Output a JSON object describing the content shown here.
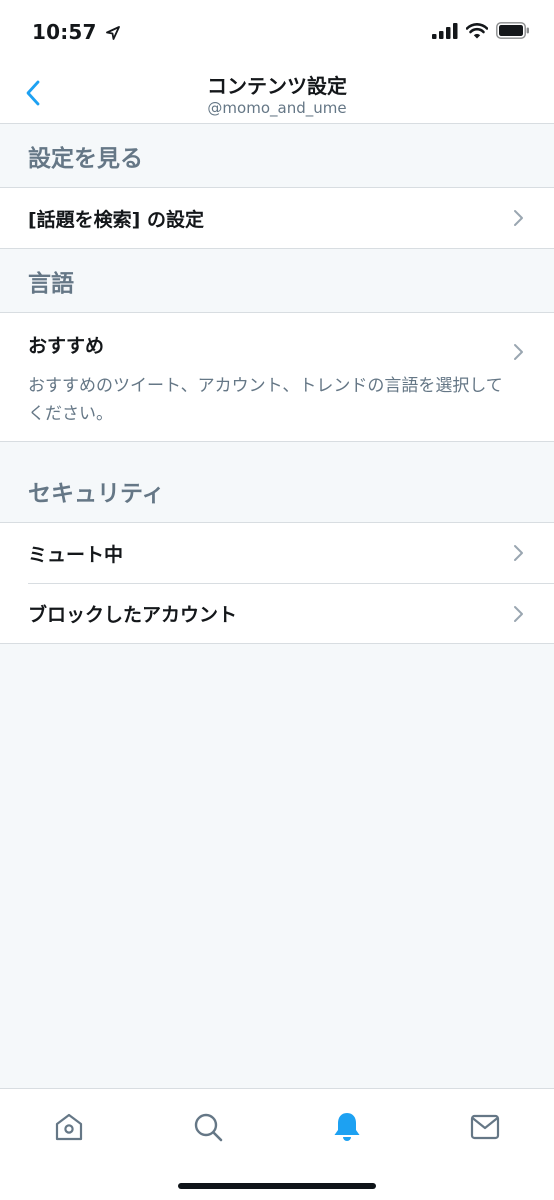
{
  "status_bar": {
    "time": "10:57"
  },
  "nav": {
    "title": "コンテンツ設定",
    "subtitle": "@momo_and_ume"
  },
  "sections": [
    {
      "header": "設定を見る",
      "rows": [
        {
          "label": "[話題を検索] の設定"
        }
      ]
    },
    {
      "header": "言語",
      "rows": [
        {
          "label": "おすすめ",
          "description": "おすすめのツイート、アカウント、トレンドの言語を選択してください。"
        }
      ]
    },
    {
      "header": "セキュリティ",
      "rows": [
        {
          "label": "ミュート中"
        },
        {
          "label": "ブロックしたアカウント"
        }
      ]
    }
  ],
  "tabs": [
    {
      "icon": "home-icon",
      "active": false
    },
    {
      "icon": "search-icon",
      "active": false
    },
    {
      "icon": "bell-icon",
      "active": true
    },
    {
      "icon": "mail-icon",
      "active": false
    }
  ],
  "colors": {
    "accent": "#1da1f2",
    "secondary_text": "#657786",
    "background": "#f5f8fa",
    "divider": "#d8dde1"
  }
}
